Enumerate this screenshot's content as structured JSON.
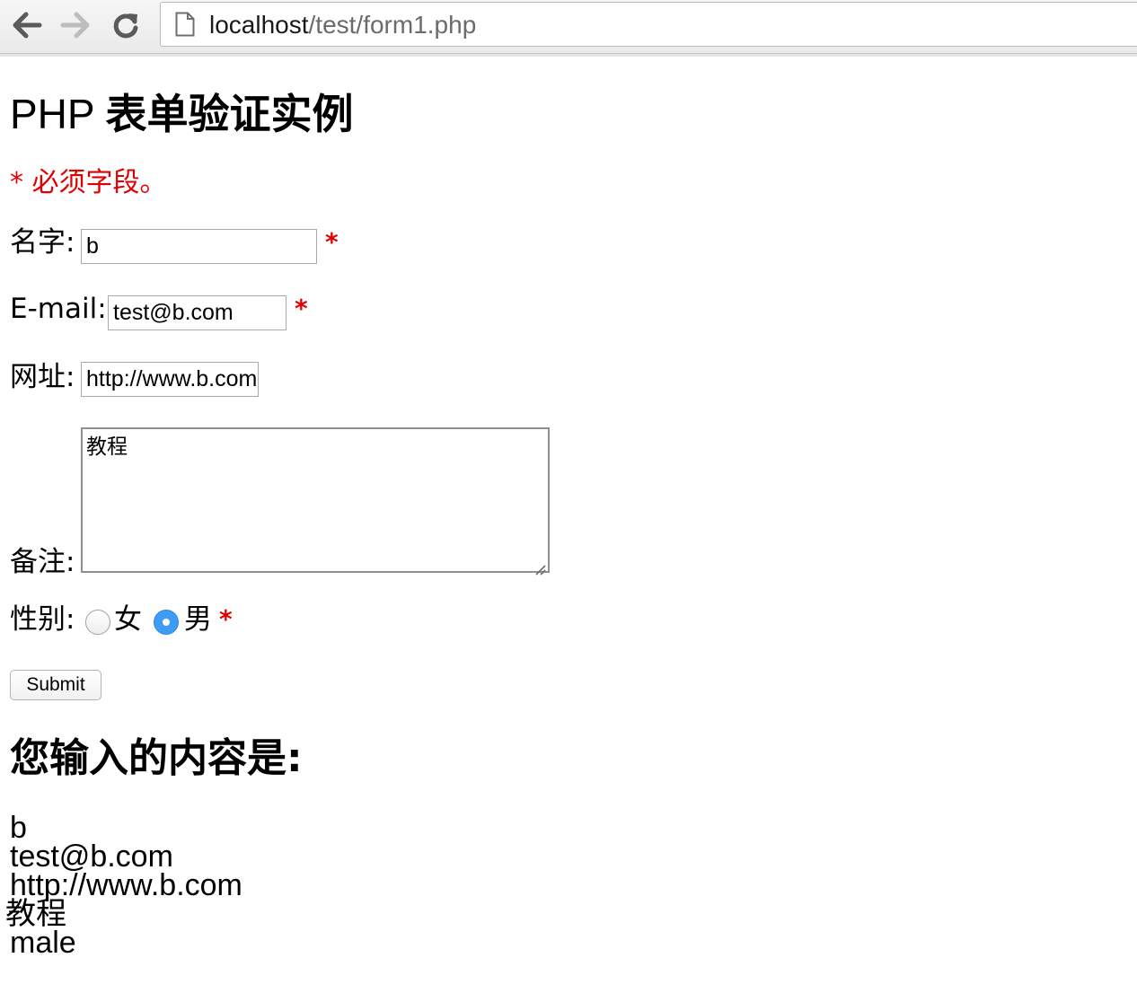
{
  "browser": {
    "url_host": "localhost",
    "url_path": "/test/form1.php",
    "icons": {
      "back": "back-arrow-icon",
      "forward": "forward-arrow-icon",
      "reload": "reload-icon",
      "page": "document-icon"
    }
  },
  "page": {
    "title_latin": "PHP ",
    "title_cjk": "表单验证实例",
    "required_note": "* 必须字段。",
    "colors": {
      "required": "#e10000",
      "radio_checked": "#3f9cf5"
    }
  },
  "form": {
    "name": {
      "label": "名字:",
      "value": "b",
      "required_mark": "*"
    },
    "email": {
      "label": "E-mail:",
      "value": "test@b.com",
      "required_mark": "*"
    },
    "website": {
      "label": "网址:",
      "value": "http://www.b.com"
    },
    "comment": {
      "label": "备注:",
      "value": "教程"
    },
    "gender": {
      "label": "性别:",
      "options": [
        {
          "label": "女",
          "checked": false
        },
        {
          "label": "男",
          "checked": true
        }
      ],
      "required_mark": "*"
    },
    "submit_label": "Submit"
  },
  "output": {
    "heading": "您输入的内容是:",
    "lines": [
      "b",
      "test@b.com",
      "http://www.b.com",
      "教程",
      "male"
    ]
  }
}
